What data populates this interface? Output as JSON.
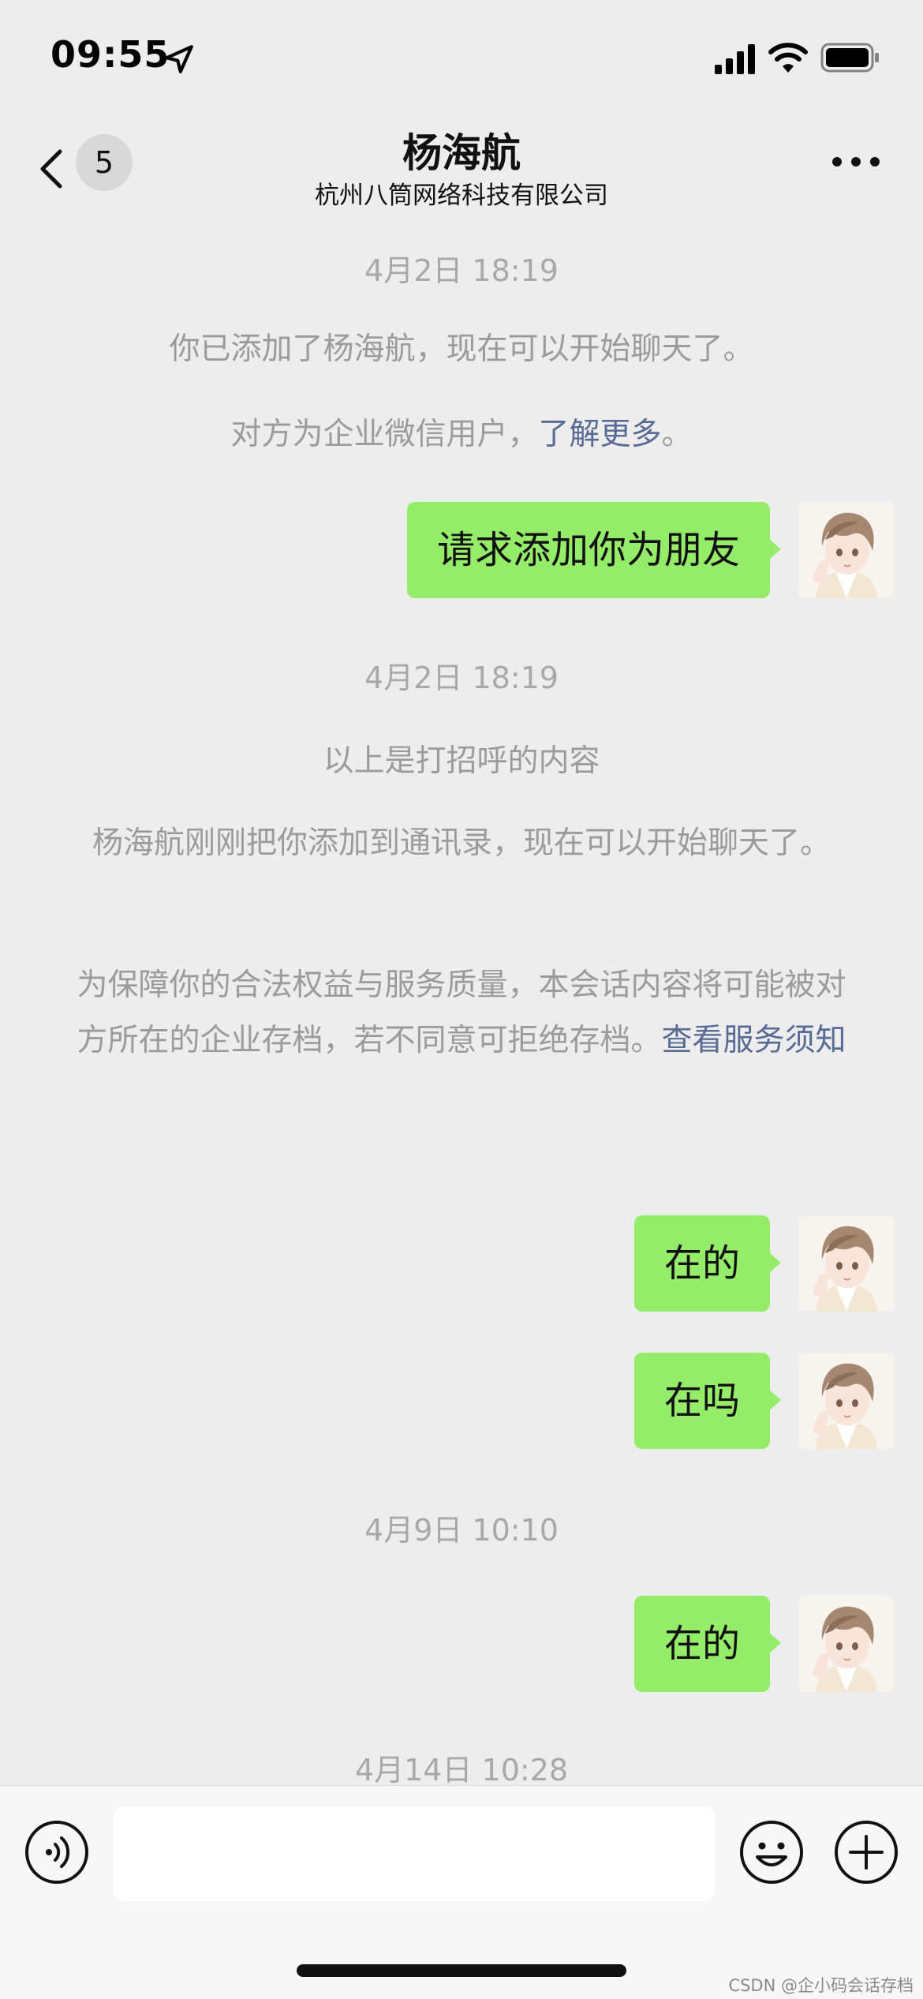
{
  "status_bar": {
    "time": "09:55",
    "icons": [
      "location-arrow-icon",
      "cellular-signal-icon",
      "wifi-icon",
      "battery-icon"
    ]
  },
  "header": {
    "back_badge": "5",
    "title": "杨海航",
    "subtitle": "杭州八筒网络科技有限公司",
    "icons": [
      "chevron-left-icon",
      "more-dots-icon"
    ]
  },
  "messages": {
    "ts1": "4月2日 18:19",
    "sys1": "你已添加了杨海航，现在可以开始聊天了。",
    "sys2_text": "对方为企业微信用户，",
    "sys2_link": "了解更多",
    "sys2_end": "。",
    "bubble1": "请求添加你为朋友",
    "ts2": "4月2日 18:19",
    "sys3": "以上是打招呼的内容",
    "sys4": "杨海航刚刚把你添加到通讯录，现在可以开始聊天了。",
    "sys5_text": "为保障你的合法权益与服务质量，本会话内容将可能被对方所在的企业存档，若不同意可拒绝存档。",
    "sys5_link": "查看服务须知",
    "bubble2": "在的",
    "bubble3": "在吗",
    "ts3": "4月9日 10:10",
    "bubble4": "在的",
    "ts4": "4月14日 10:28"
  },
  "input_bar": {
    "placeholder": "",
    "icons": [
      "voice-icon",
      "emoji-icon",
      "plus-icon"
    ]
  },
  "watermark": "CSDN @企小码会话存档",
  "colors": {
    "background": "#ededed",
    "bubble": "#95ec69",
    "link": "#576b95",
    "system_text": "#9b9b9b"
  }
}
